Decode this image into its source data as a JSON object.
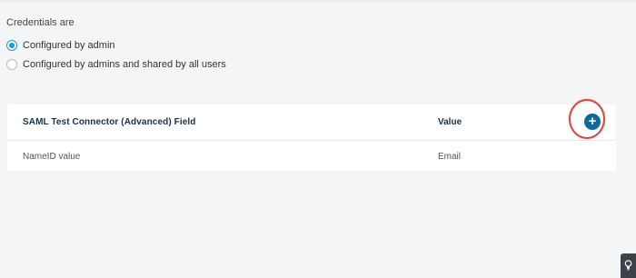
{
  "credentials": {
    "label": "Credentials are",
    "options": [
      {
        "label": "Configured by admin",
        "selected": true
      },
      {
        "label": "Configured by admins and shared by all users",
        "selected": false
      }
    ]
  },
  "table": {
    "headers": {
      "field": "SAML Test Connector (Advanced) Field",
      "value": "Value"
    },
    "add_button_icon": "plus-icon",
    "rows": [
      {
        "field": "NameID value",
        "value": "Email"
      }
    ]
  },
  "colors": {
    "accent": "#1a9ad6",
    "add_button": "#0e6a96",
    "highlight": "#d6453f",
    "header_text": "#17324a"
  },
  "help_widget_icon": "lightbulb-icon"
}
